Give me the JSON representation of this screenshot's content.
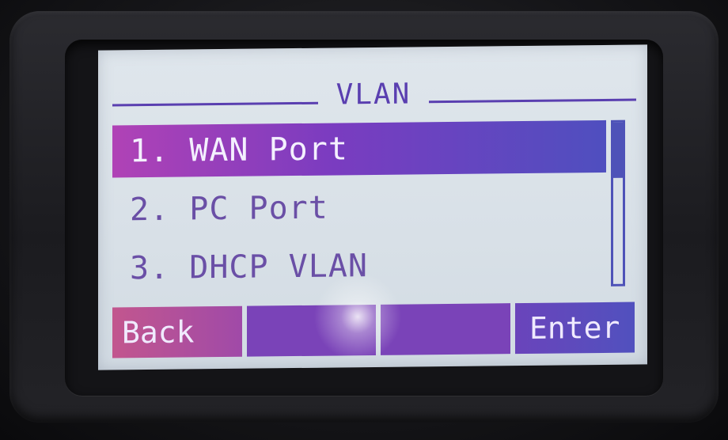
{
  "screen": {
    "title": "VLAN"
  },
  "menu": {
    "items": [
      {
        "label": "1. WAN Port",
        "selected": true
      },
      {
        "label": "2. PC Port",
        "selected": false
      },
      {
        "label": "3. DHCP VLAN",
        "selected": false
      }
    ]
  },
  "softkeys": {
    "key1": "Back",
    "key2": "",
    "key3": "",
    "key4": "Enter"
  },
  "colors": {
    "screen_bg": "#dfe6ec",
    "accent": "#5a3fb0",
    "selection": "#7a3cc0"
  }
}
